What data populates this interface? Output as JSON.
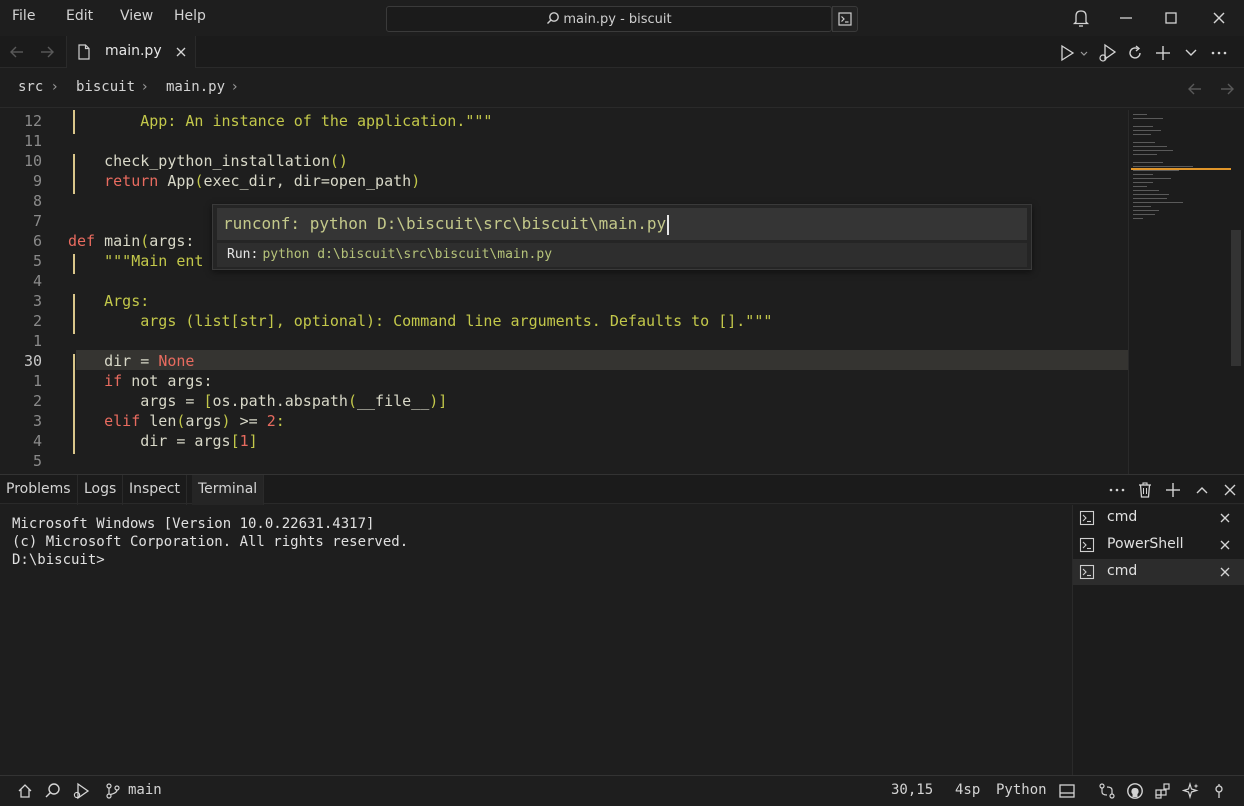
{
  "menu": [
    "File",
    "Edit",
    "View",
    "Help"
  ],
  "title": "main.py - biscuit",
  "tab": {
    "label": "main.py"
  },
  "breadcrumb": [
    "src",
    "biscuit",
    "main.py"
  ],
  "editor": {
    "lines": [
      {
        "n": "12",
        "html": "        <span class='str'>App: An instance of the application.\"\"\"</span>"
      },
      {
        "n": "11",
        "html": ""
      },
      {
        "n": "10",
        "html": "    <span class='fn'>check_python_installation</span><span class='op'>()</span>"
      },
      {
        "n": "9",
        "html": "    <span class='kw'>return</span> <span class='fn'>App</span><span class='op'>(</span>exec_dir, dir=open_path<span class='op'>)</span>"
      },
      {
        "n": "8",
        "html": ""
      },
      {
        "n": "7",
        "html": ""
      },
      {
        "n": "6",
        "html": "<span class='kw'>def</span> <span class='fn'>main</span><span class='op'>(</span>args:"
      },
      {
        "n": "5",
        "html": "    <span class='str'>\"\"\"Main ent</span>"
      },
      {
        "n": "4",
        "html": ""
      },
      {
        "n": "3",
        "html": "    <span class='str'>Args:</span>"
      },
      {
        "n": "2",
        "html": "        <span class='str'>args (list[str], optional): Command line arguments. Defaults to [].\"\"\"</span>"
      },
      {
        "n": "1",
        "html": ""
      },
      {
        "n": "30",
        "html": "    dir = <span class='kw'>None</span>",
        "current": true
      },
      {
        "n": "1",
        "html": "    <span class='kw'>if</span> not args:"
      },
      {
        "n": "2",
        "html": "        args = <span class='op'>[</span>os.path.abspath<span class='op'>(</span>__file__<span class='op'>)]</span>"
      },
      {
        "n": "3",
        "html": "    <span class='kw'>elif</span> len<span class='op'>(</span>args<span class='op'>)</span> >= <span class='num'>2</span><span class='op'>:</span>"
      },
      {
        "n": "4",
        "html": "        dir = args<span class='op'>[</span><span class='num'>1</span><span class='op'>]</span>"
      },
      {
        "n": "5",
        "html": ""
      }
    ]
  },
  "palette": {
    "input": "runconf: python D:\\biscuit\\src\\biscuit\\main.py",
    "item_key": "Run:",
    "item_value": "python d:\\biscuit\\src\\biscuit\\main.py"
  },
  "panel": {
    "tabs": [
      "Problems",
      "Logs",
      "Inspect",
      "Terminal"
    ]
  },
  "terminal": {
    "lines": [
      "Microsoft Windows [Version 10.0.22631.4317]",
      "(c) Microsoft Corporation. All rights reserved.",
      "D:\\biscuit>"
    ],
    "sessions": [
      "cmd",
      "PowerShell",
      "cmd"
    ]
  },
  "status": {
    "branch": "main",
    "position": "30,15",
    "indent": "4sp",
    "language": "Python"
  }
}
